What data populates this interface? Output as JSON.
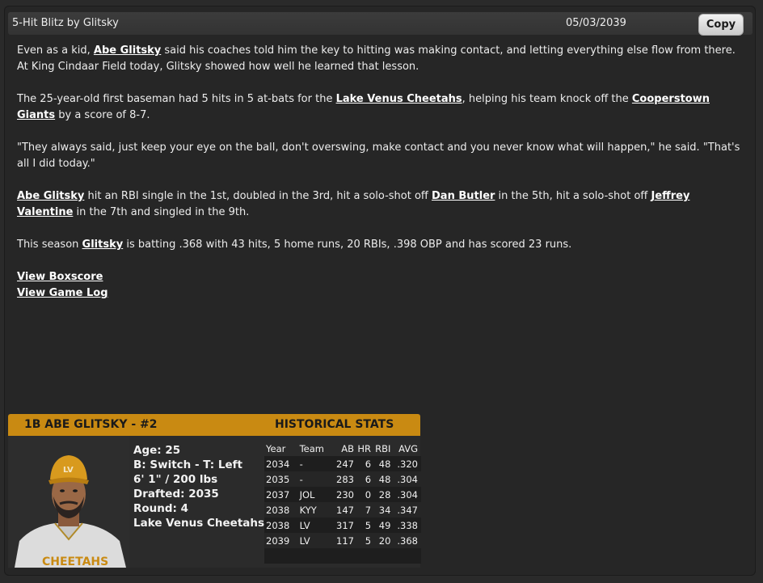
{
  "header": {
    "title": "5-Hit Blitz by Glitsky",
    "date": "05/03/2039",
    "copy_label": "Copy"
  },
  "article": {
    "p1": {
      "t1": "Even as a kid, ",
      "link1": "Abe Glitsky",
      "t2": " said his coaches told him the key to hitting was making contact, and letting everything else flow from there. At King Cindaar Field today, Glitsky showed how well he learned that lesson."
    },
    "p2": {
      "t1": "The 25-year-old first baseman had 5 hits in 5 at-bats for the ",
      "link1": "Lake Venus Cheetahs",
      "t2": ", helping his team knock off the ",
      "link2": "Cooperstown Giants",
      "t3": " by a score of 8-7."
    },
    "p3": "\"They always said, just keep your eye on the ball, don't overswing, make contact and you never know what will happen,\" he said. \"That's all I did today.\"",
    "p4": {
      "link1": "Abe Glitsky",
      "t1": " hit an RBI single in the 1st, doubled in the 3rd, hit a solo-shot off ",
      "link2": "Dan Butler",
      "t2": " in the 5th, hit a solo-shot off ",
      "link3": "Jeffrey Valentine",
      "t3": " in the 7th and singled in the 9th."
    },
    "p5": {
      "t1": "This season ",
      "link1": "Glitsky",
      "t2": " is batting .368 with 43 hits, 5 home runs, 20 RBIs, .398 OBP and has scored 23 runs."
    },
    "links": {
      "boxscore": "View Boxscore",
      "gamelog": "View Game Log"
    }
  },
  "player_card": {
    "name": "1B ABE GLITSKY - #2",
    "historical_label": "HISTORICAL STATS",
    "info": [
      "Age: 25",
      "B: Switch - T: Left",
      "6' 1\" / 200 lbs",
      "Drafted: 2035",
      "Round: 4",
      "Lake Venus Cheetahs"
    ],
    "stats_headers": [
      "Year",
      "Team",
      "AB",
      "HR",
      "RBI",
      "AVG"
    ],
    "stats_rows": [
      [
        "2034",
        "-",
        "247",
        "6",
        "48",
        ".320"
      ],
      [
        "2035",
        "-",
        "283",
        "6",
        "48",
        ".304"
      ],
      [
        "2037",
        "JOL",
        "230",
        "0",
        "28",
        ".304"
      ],
      [
        "2038",
        "KYY",
        "147",
        "7",
        "34",
        ".347"
      ],
      [
        "2038",
        "LV",
        "317",
        "5",
        "49",
        ".338"
      ],
      [
        "2039",
        "LV",
        "117",
        "5",
        "20",
        ".368"
      ]
    ],
    "cap_text": "LV",
    "jersey_text": "CHEETAHS"
  },
  "colors": {
    "accent": "#c98a12",
    "background": "#262626"
  }
}
